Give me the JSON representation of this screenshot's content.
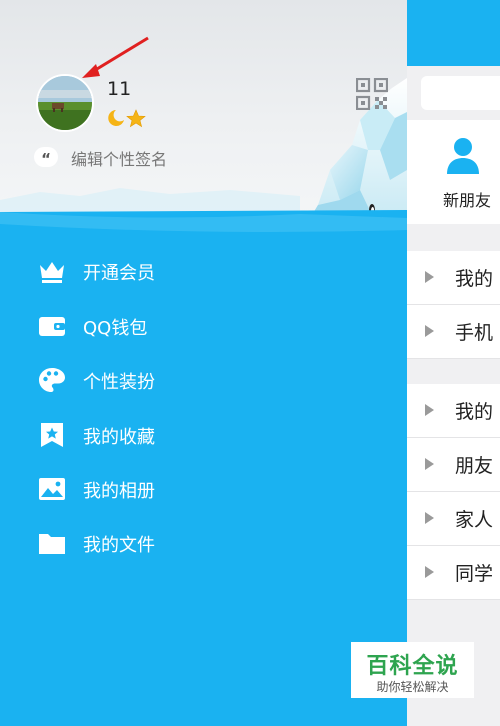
{
  "profile": {
    "nickname": "11",
    "signature_placeholder": "编辑个性签名"
  },
  "icons": {
    "qr": "qr-code-icon",
    "quote": "quote-icon",
    "level": [
      "moon-icon",
      "star-icon"
    ]
  },
  "menu": [
    {
      "label": "开通会员",
      "icon": "crown-icon"
    },
    {
      "label": "QQ钱包",
      "icon": "wallet-icon"
    },
    {
      "label": "个性装扮",
      "icon": "palette-icon"
    },
    {
      "label": "我的收藏",
      "icon": "bookmark-star-icon"
    },
    {
      "label": "我的相册",
      "icon": "photo-icon"
    },
    {
      "label": "我的文件",
      "icon": "folder-icon"
    }
  ],
  "contacts": {
    "new_friends": "新朋友",
    "groups": [
      "我的",
      "手机",
      "我的",
      "朋友",
      "家人",
      "同学"
    ]
  },
  "watermark": {
    "title": "百科全说",
    "subtitle": "助你轻松解决"
  },
  "colors": {
    "drawer_blue": "#1ab2f1",
    "header_blue": "#1ab2f1",
    "watermark_green": "#2ea44f",
    "annotation_red": "#e02020"
  }
}
